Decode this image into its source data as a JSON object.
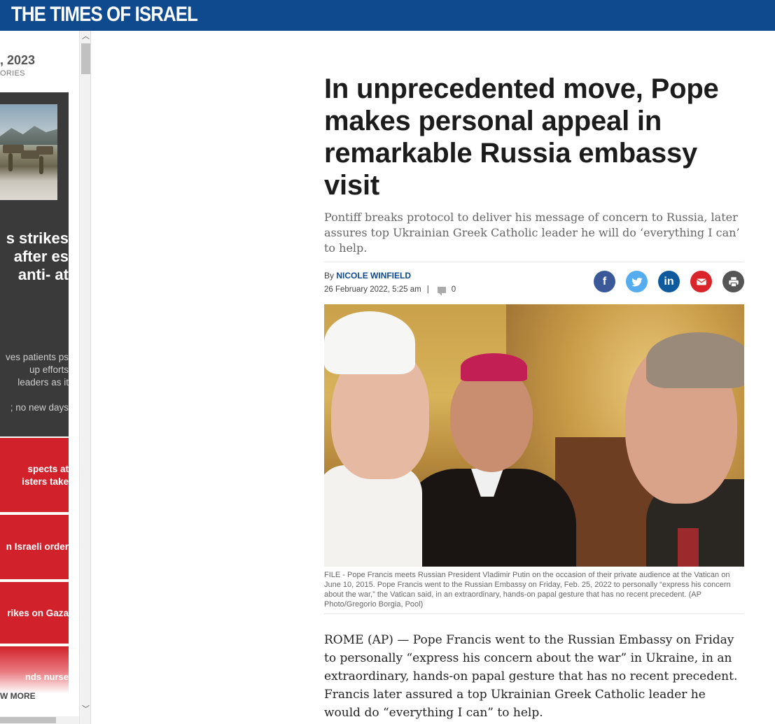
{
  "header": {
    "logo": "THE TIMES OF ISRAEL",
    "bg": "#0f4a8f"
  },
  "sidebar": {
    "date": ", 2023",
    "sub": "ORIES",
    "headline": "s strikes after es anti- at",
    "text1": "ves patients ps up efforts leaders as it",
    "text2": "; no new days",
    "red_items": [
      "spects at isters take",
      "n Israeli order",
      "rikes on Gaza"
    ],
    "fade_item": "nds nurse",
    "more": "W MORE",
    "accent": "#d1222c"
  },
  "article": {
    "headline": "In unprecedented move, Pope makes personal appeal in remarkable Russia embassy visit",
    "subhead": "Pontiff breaks protocol to deliver his message of concern to Russia, later assures top Ukrainian Greek Catholic leader he will do ‘everything I can’ to help.",
    "by_prefix": "By",
    "author": "NICOLE WINFIELD",
    "date": "26 February 2022, 5:25 am",
    "separator": "|",
    "comments": "0",
    "share": [
      {
        "name": "facebook",
        "glyph": "f",
        "color": "#3b5998"
      },
      {
        "name": "twitter",
        "glyph": "t",
        "color": "#55acee"
      },
      {
        "name": "linkedin",
        "glyph": "in",
        "color": "#0e5a9c"
      },
      {
        "name": "email",
        "glyph": "✉",
        "color": "#d9252a"
      },
      {
        "name": "print",
        "glyph": "⎙",
        "color": "#555555"
      }
    ],
    "caption": "FILE - Pope Francis meets Russian President Vladimir Putin on the occasion of their private audience at the Vatican on June 10, 2015. Pope Francis went to the Russian Embassy on Friday, Feb. 25, 2022 to personally “express his concern about the war,” the Vatican said, in an extraordinary, hands-on papal gesture that has no recent precedent. (AP Photo/Gregorio Borgia, Pool)",
    "body": "ROME (AP) — Pope Francis went to the Russian Embassy on Friday to personally “express his concern about the war” in Ukraine, in an extraordinary, hands-on papal gesture that has no recent precedent. Francis later assured a top Ukrainian Greek Catholic leader he would do “everything I can” to help."
  }
}
